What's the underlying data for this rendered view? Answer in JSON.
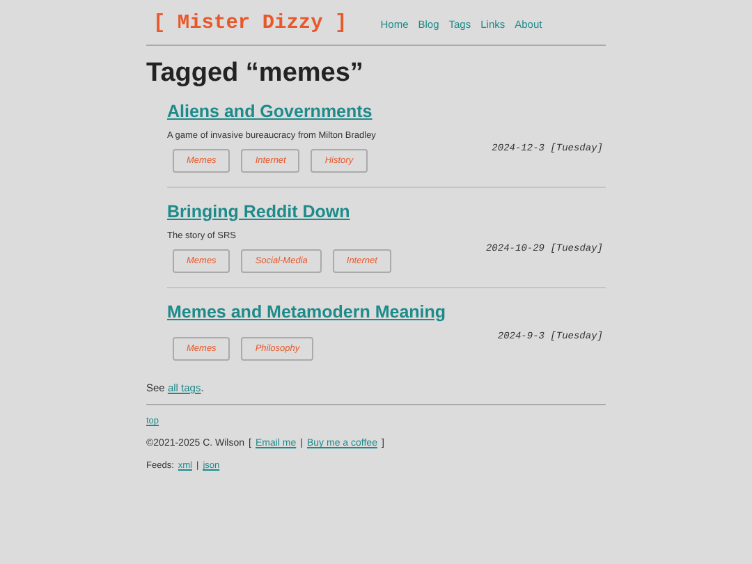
{
  "header": {
    "logo": "[ Mister Dizzy ]",
    "nav": [
      {
        "label": "Home"
      },
      {
        "label": "Blog"
      },
      {
        "label": "Tags"
      },
      {
        "label": "Links"
      },
      {
        "label": "About"
      }
    ]
  },
  "heading": "Tagged “memes”",
  "posts": [
    {
      "title": "Aliens and Governments",
      "description": "A game of invasive bureaucracy from Milton Bradley",
      "tags": [
        "Memes",
        "Internet",
        "History"
      ],
      "date": "2024-12-3 [Tuesday]"
    },
    {
      "title": "Bringing Reddit Down",
      "description": "The story of SRS",
      "tags": [
        "Memes",
        "Social-Media",
        "Internet"
      ],
      "date": "2024-10-29 [Tuesday]"
    },
    {
      "title": "Memes and Metamodern Meaning",
      "tags": [
        "Memes",
        "Philosophy"
      ],
      "date": "2024-9-3 [Tuesday]"
    }
  ],
  "see_all": {
    "before": "See ",
    "link": "all tags",
    "after": "."
  },
  "footer": {
    "top_link": "top",
    "copyright": "©2021-2025 C. Wilson",
    "open": "[",
    "links": [
      "Email me",
      "Buy me a coffee"
    ],
    "separator": "|",
    "close": "]",
    "feeds_label": "Feeds:",
    "feeds": [
      "xml",
      "json"
    ]
  }
}
